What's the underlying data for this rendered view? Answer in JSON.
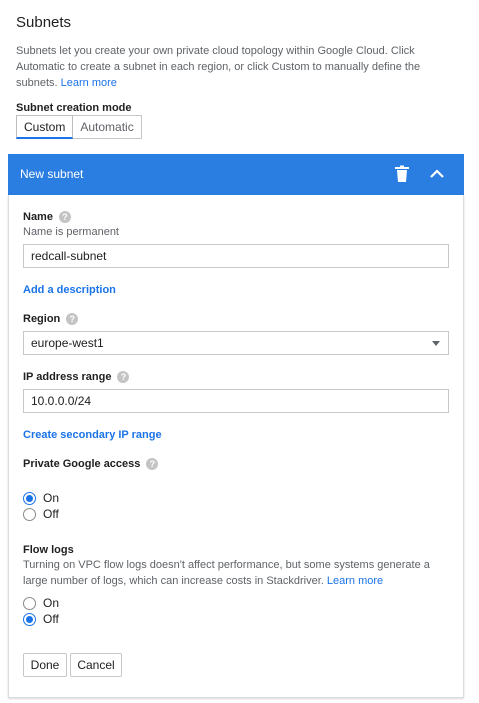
{
  "section": {
    "title": "Subnets",
    "description": "Subnets let you create your own private cloud topology within Google Cloud. Click Automatic to create a subnet in each region, or click Custom to manually define the subnets.",
    "learn_more": "Learn more"
  },
  "creation_mode": {
    "label": "Subnet creation mode",
    "options": [
      "Custom",
      "Automatic"
    ],
    "selected": "Custom"
  },
  "panel": {
    "title": "New subnet",
    "icons": [
      "trash-icon",
      "chevron-up-icon"
    ]
  },
  "form": {
    "name": {
      "label": "Name",
      "hint": "Name is permanent",
      "value": "redcall-subnet"
    },
    "add_description": "Add a description",
    "region": {
      "label": "Region",
      "value": "europe-west1"
    },
    "ip_range": {
      "label": "IP address range",
      "value": "10.0.0.0/24"
    },
    "create_secondary": "Create secondary IP range",
    "private_google_access": {
      "label": "Private Google access",
      "options": [
        "On",
        "Off"
      ],
      "selected": "On"
    },
    "flow_logs": {
      "label": "Flow logs",
      "description": "Turning on VPC flow logs doesn't affect performance, but some systems generate a large number of logs, which can increase costs in Stackdriver.",
      "learn_more": "Learn more",
      "options": [
        "On",
        "Off"
      ],
      "selected": "Off"
    }
  },
  "actions": {
    "done": "Done",
    "cancel": "Cancel"
  },
  "colors": {
    "accent": "#2a7de1",
    "link": "#1a73e8",
    "help_icon": "#c4c4c4"
  }
}
